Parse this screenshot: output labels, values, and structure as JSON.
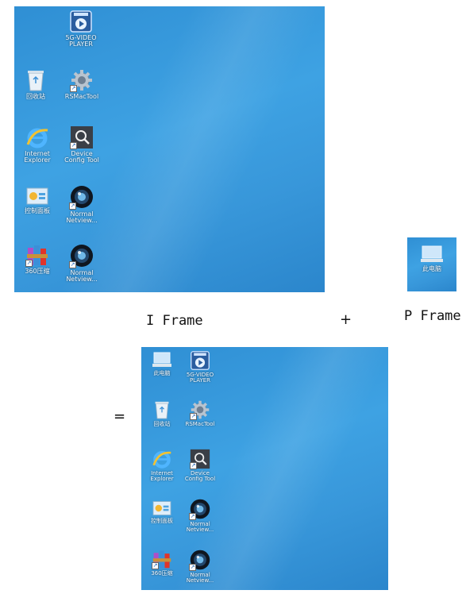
{
  "captions": {
    "i_frame": "I Frame",
    "p_frame": "P Frame",
    "plus": "+",
    "equals": "="
  },
  "i_frame_icons": {
    "video_player": "5G-VIDEO PLAYER",
    "recycle_bin": "回收站",
    "rsmactool": "RSMacTool",
    "internet_explorer": "Internet Explorer",
    "device_config": "Device Config Tool",
    "control_panel": "控制面板",
    "normal_netview_1": "Normal Netview...",
    "winrar": "360压缩",
    "normal_netview_2": "Normal Netview..."
  },
  "p_frame_icons": {
    "this_pc": "此电脑"
  },
  "result_icons": {
    "this_pc": "此电脑",
    "video_player": "5G-VIDEO PLAYER",
    "recycle_bin": "回收站",
    "rsmactool": "RSMacTool",
    "internet_explorer": "Internet Explorer",
    "device_config": "Device Config Tool",
    "control_panel": "控制面板",
    "normal_netview_1": "Normal Netview...",
    "winrar": "360压缩",
    "normal_netview_2": "Normal Netview..."
  }
}
